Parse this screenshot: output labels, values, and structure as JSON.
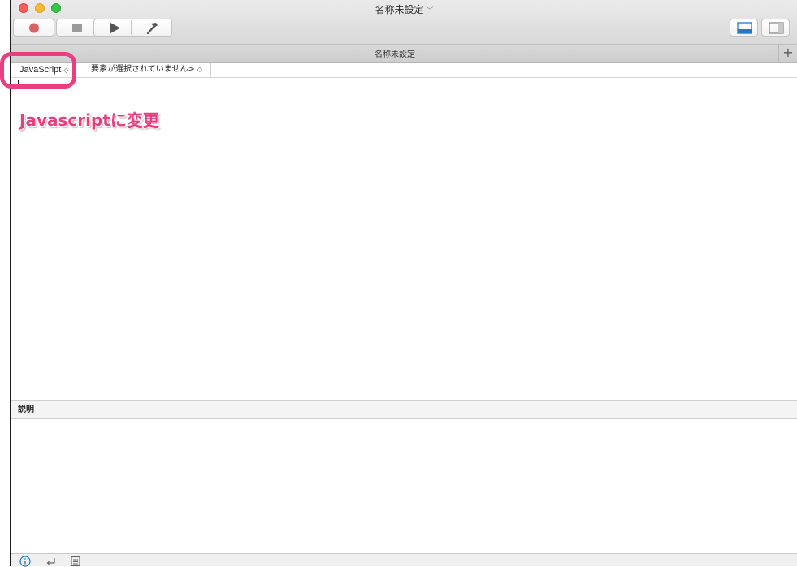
{
  "window": {
    "title": "名称未設定",
    "title_chevron": "﹀"
  },
  "toolbar": {
    "record_icon": "record-icon",
    "stop_icon": "stop-icon",
    "run_icon": "play-icon",
    "compile_icon": "hammer-icon",
    "accent": "#1f78c8"
  },
  "tab": {
    "title": "名称未設定",
    "add_label": "+"
  },
  "navbar": {
    "language": "JavaScript",
    "element": "要素が選択されていません>",
    "updown_glyph": "◇"
  },
  "annotation": {
    "text": "Javascriptに変更",
    "color": "#e8407f"
  },
  "description": {
    "header": "説明"
  },
  "bottombar": {
    "icons": [
      "info-icon",
      "return-icon",
      "log-icon"
    ]
  }
}
